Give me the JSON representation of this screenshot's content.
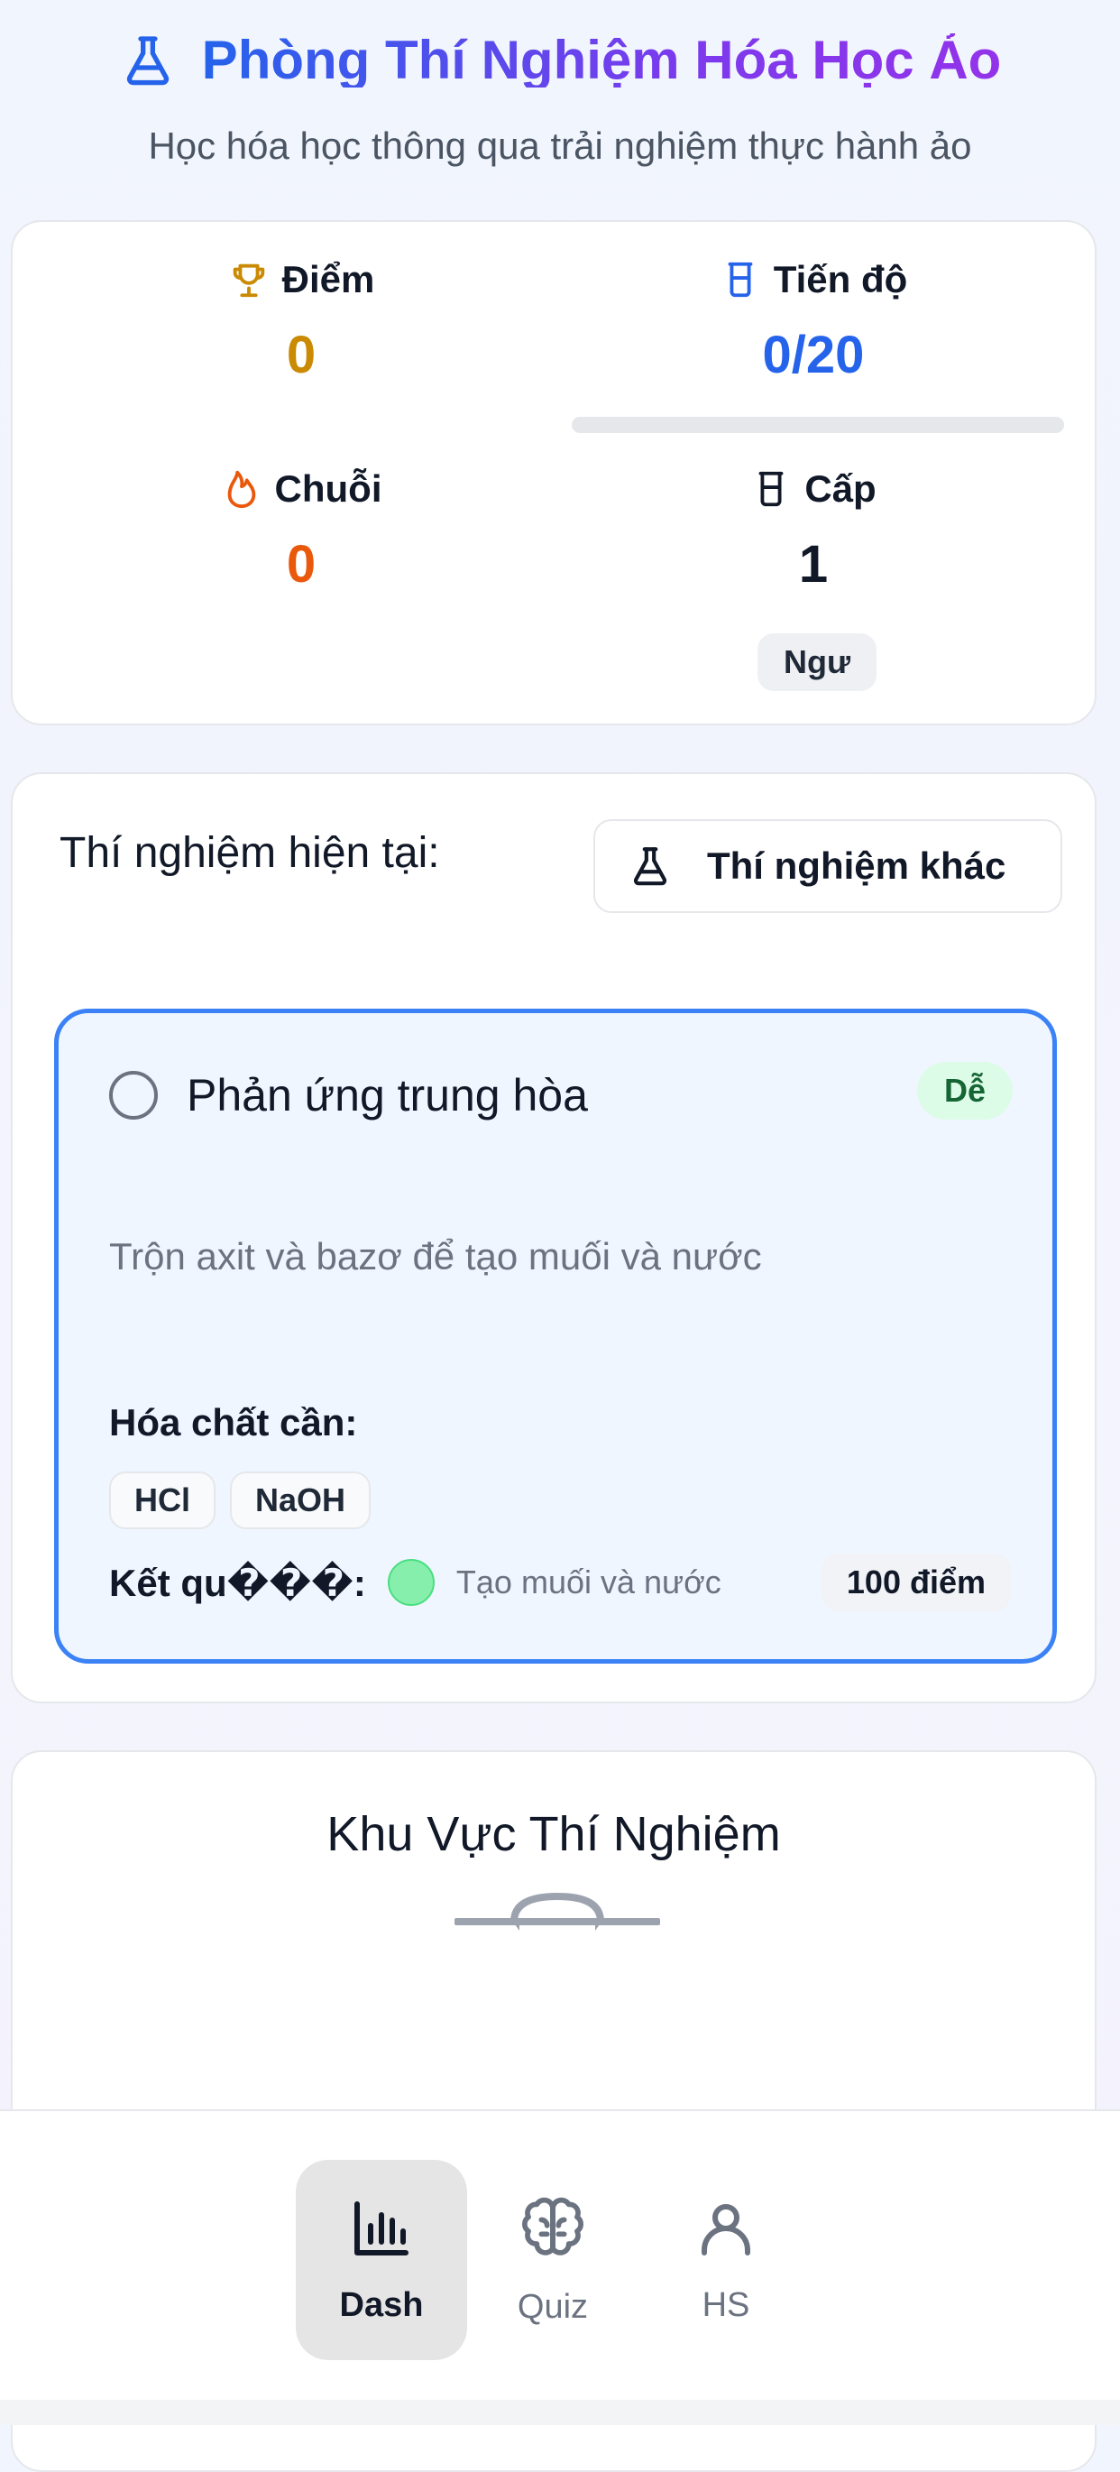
{
  "header": {
    "title": "Phòng Thí Nghiệm Hóa Học Ảo",
    "subtitle": "Học hóa học thông qua trải nghiệm thực hành ảo",
    "icon": "flask-icon"
  },
  "stats": {
    "points": {
      "label": "Điểm",
      "value": "0",
      "icon": "trophy-icon",
      "color": "#ca8a04"
    },
    "progress": {
      "label": "Tiến độ",
      "value": "0/20",
      "icon": "beaker-icon",
      "color": "#2563eb",
      "completed": 0,
      "total": 20
    },
    "streak": {
      "label": "Chuỗi",
      "value": "0",
      "icon": "flame-icon",
      "color": "#ea580c"
    },
    "level": {
      "label": "Cấp",
      "value": "1",
      "badge": "Ngư",
      "icon": "beaker-icon"
    }
  },
  "experiment": {
    "current_label": "Thí nghiệm hiện tại:",
    "other_button": "Thí nghiệm khác",
    "name": "Phản ứng trung hòa",
    "difficulty": "Dễ",
    "description": "Trộn axit và bazơ để tạo muối và nước",
    "chemicals_label": "Hóa chất cần:",
    "chemicals": [
      "HCl",
      "NaOH"
    ],
    "result_label": "Kết qu���:",
    "result_text": "Tạo muối và nước",
    "result_color": "#86efac",
    "points": "100 điểm"
  },
  "lab": {
    "title": "Khu Vực Thí Nghiệm"
  },
  "nav": {
    "items": [
      {
        "label": "Dash",
        "icon": "bar-chart-icon",
        "active": true
      },
      {
        "label": "Quiz",
        "icon": "brain-icon",
        "active": false
      },
      {
        "label": "HS",
        "icon": "user-icon",
        "active": false
      }
    ]
  }
}
